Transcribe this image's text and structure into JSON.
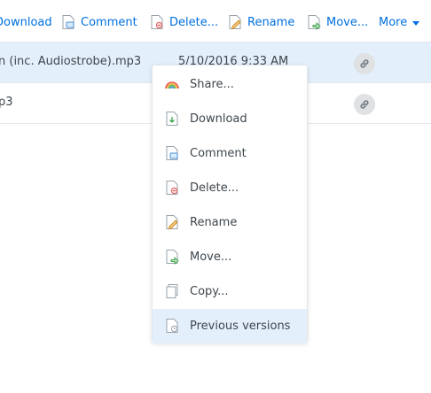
{
  "toolbar": {
    "download_label": "Download",
    "comment_label": "Comment",
    "delete_label": "Delete...",
    "rename_label": "Rename",
    "move_label": "Move...",
    "more_label": "More"
  },
  "files": [
    {
      "name": "n (inc. Audiostrobe).mp3",
      "date": "5/10/2016 9:33 AM",
      "selected": true
    },
    {
      "name": "p3",
      "date": "",
      "selected": false
    }
  ],
  "menu": {
    "items": [
      {
        "label": "Share...",
        "icon": "share-rainbow-icon"
      },
      {
        "label": "Download",
        "icon": "download-icon"
      },
      {
        "label": "Comment",
        "icon": "comment-icon"
      },
      {
        "label": "Delete...",
        "icon": "delete-icon"
      },
      {
        "label": "Rename",
        "icon": "rename-icon"
      },
      {
        "label": "Move...",
        "icon": "move-icon"
      },
      {
        "label": "Copy...",
        "icon": "copy-icon"
      },
      {
        "label": "Previous versions",
        "icon": "previous-versions-icon"
      }
    ],
    "highlighted": "Previous versions"
  },
  "colors": {
    "accent": "#0070e0",
    "selected_row": "#e3f0fb",
    "text": "#3d464d"
  }
}
